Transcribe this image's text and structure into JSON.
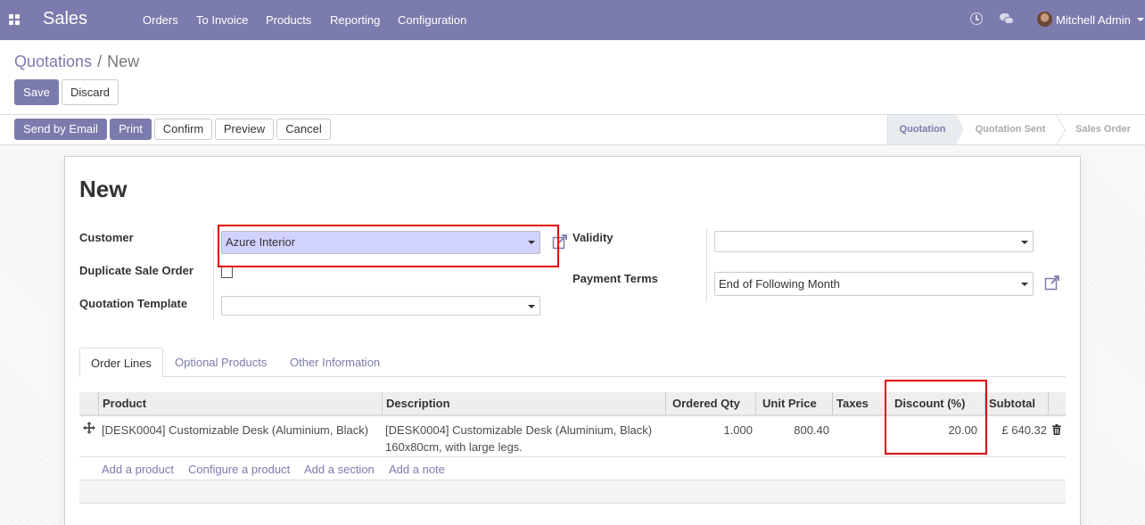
{
  "navbar": {
    "brand": "Sales",
    "menu": [
      "Orders",
      "To Invoice",
      "Products",
      "Reporting",
      "Configuration"
    ],
    "user": "Mitchell Admin",
    "icons": [
      "apps-grid-icon",
      "clock-icon",
      "chat-icon",
      "avatar"
    ]
  },
  "breadcrumb": {
    "parent": "Quotations",
    "separator": "/",
    "current": "New"
  },
  "control_buttons": {
    "save": "Save",
    "discard": "Discard"
  },
  "actions": {
    "send_email": "Send by Email",
    "print": "Print",
    "confirm": "Confirm",
    "preview": "Preview",
    "cancel": "Cancel"
  },
  "status_steps": [
    "Quotation",
    "Quotation Sent",
    "Sales Order"
  ],
  "status_active": "Quotation",
  "form": {
    "title": "New",
    "customer_label": "Customer",
    "customer_value": "Azure Interior",
    "duplicate_label": "Duplicate Sale Order",
    "template_label": "Quotation Template",
    "template_value": "",
    "validity_label": "Validity",
    "validity_value": "",
    "payment_label": "Payment Terms",
    "payment_value": "End of Following Month"
  },
  "tabs": [
    "Order Lines",
    "Optional Products",
    "Other Information"
  ],
  "table": {
    "headers": [
      "Product",
      "Description",
      "Ordered Qty",
      "Unit Price",
      "Taxes",
      "Discount (%)",
      "Subtotal"
    ],
    "rows": [
      {
        "product": "[DESK0004] Customizable Desk (Aluminium, Black)",
        "description_line1": "[DESK0004] Customizable Desk (Aluminium, Black)",
        "description_line2": "160x80cm, with large legs.",
        "qty": "1.000",
        "unit_price": "800.40",
        "taxes": "",
        "discount": "20.00",
        "subtotal": "£ 640.32"
      }
    ],
    "add_links": [
      "Add a product",
      "Configure a product",
      "Add a section",
      "Add a note"
    ]
  },
  "colors": {
    "brand": "#7c7bad",
    "highlight": "#d2d2ff",
    "annotation": "#e00000"
  }
}
